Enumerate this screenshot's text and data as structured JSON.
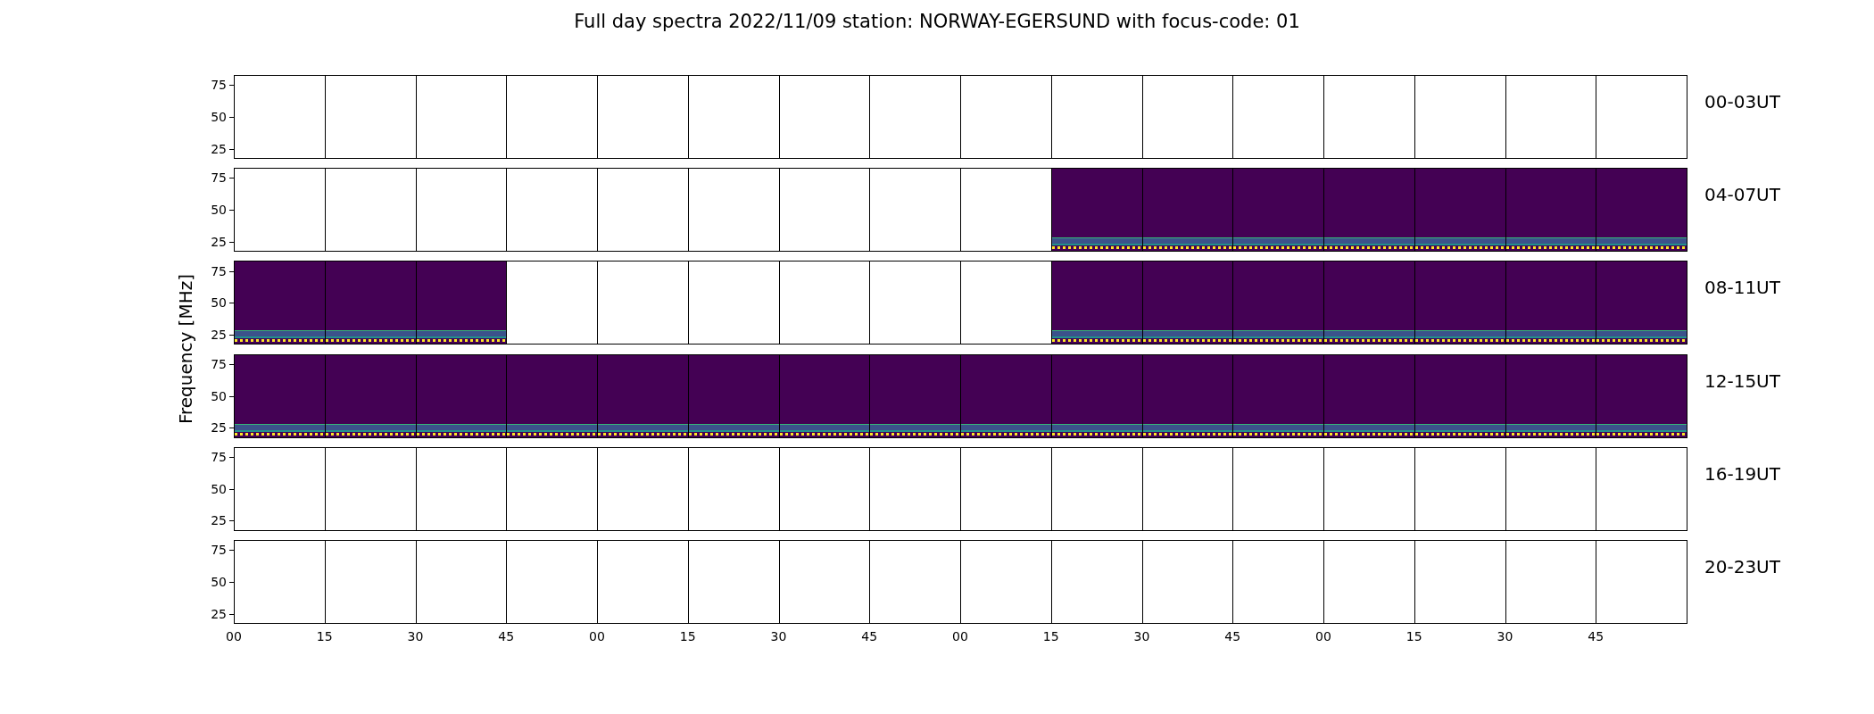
{
  "title": "Full day spectra 2022/11/09 station: NORWAY-EGERSUND with focus-code: 01",
  "ylabel": "Frequency [MHz]",
  "rows": [
    {
      "label": "00-03UT",
      "yticks": [
        "75",
        "50",
        "25"
      ],
      "panels": [
        {
          "has_data": false
        },
        {
          "has_data": false
        },
        {
          "has_data": false
        },
        {
          "has_data": false
        },
        {
          "has_data": false
        },
        {
          "has_data": false
        },
        {
          "has_data": false
        },
        {
          "has_data": false
        },
        {
          "has_data": false
        },
        {
          "has_data": false
        },
        {
          "has_data": false
        },
        {
          "has_data": false
        },
        {
          "has_data": false
        },
        {
          "has_data": false
        },
        {
          "has_data": false
        },
        {
          "has_data": false
        }
      ]
    },
    {
      "label": "04-07UT",
      "yticks": [
        "75",
        "50",
        "25"
      ],
      "panels": [
        {
          "has_data": false
        },
        {
          "has_data": false
        },
        {
          "has_data": false
        },
        {
          "has_data": false
        },
        {
          "has_data": false
        },
        {
          "has_data": false
        },
        {
          "has_data": false
        },
        {
          "has_data": false
        },
        {
          "has_data": false
        },
        {
          "has_data": true
        },
        {
          "has_data": true
        },
        {
          "has_data": true
        },
        {
          "has_data": true
        },
        {
          "has_data": true
        },
        {
          "has_data": true
        },
        {
          "has_data": true
        }
      ]
    },
    {
      "label": "08-11UT",
      "yticks": [
        "75",
        "50",
        "25"
      ],
      "panels": [
        {
          "has_data": true
        },
        {
          "has_data": true
        },
        {
          "has_data": true
        },
        {
          "has_data": false
        },
        {
          "has_data": false
        },
        {
          "has_data": false
        },
        {
          "has_data": false
        },
        {
          "has_data": false
        },
        {
          "has_data": false
        },
        {
          "has_data": true
        },
        {
          "has_data": true
        },
        {
          "has_data": true
        },
        {
          "has_data": true
        },
        {
          "has_data": true
        },
        {
          "has_data": true
        },
        {
          "has_data": true
        }
      ]
    },
    {
      "label": "12-15UT",
      "yticks": [
        "75",
        "50",
        "25"
      ],
      "panels": [
        {
          "has_data": true
        },
        {
          "has_data": true
        },
        {
          "has_data": true
        },
        {
          "has_data": true
        },
        {
          "has_data": true
        },
        {
          "has_data": true
        },
        {
          "has_data": true
        },
        {
          "has_data": true
        },
        {
          "has_data": true
        },
        {
          "has_data": true
        },
        {
          "has_data": true
        },
        {
          "has_data": true
        },
        {
          "has_data": true
        },
        {
          "has_data": true
        },
        {
          "has_data": true
        },
        {
          "has_data": true
        }
      ]
    },
    {
      "label": "16-19UT",
      "yticks": [
        "75",
        "50",
        "25"
      ],
      "panels": [
        {
          "has_data": false
        },
        {
          "has_data": false
        },
        {
          "has_data": false
        },
        {
          "has_data": false
        },
        {
          "has_data": false
        },
        {
          "has_data": false
        },
        {
          "has_data": false
        },
        {
          "has_data": false
        },
        {
          "has_data": false
        },
        {
          "has_data": false
        },
        {
          "has_data": false
        },
        {
          "has_data": false
        },
        {
          "has_data": false
        },
        {
          "has_data": false
        },
        {
          "has_data": false
        },
        {
          "has_data": false
        }
      ]
    },
    {
      "label": "20-23UT",
      "yticks": [
        "75",
        "50",
        "25"
      ],
      "panels": [
        {
          "has_data": false
        },
        {
          "has_data": false
        },
        {
          "has_data": false
        },
        {
          "has_data": false
        },
        {
          "has_data": false
        },
        {
          "has_data": false
        },
        {
          "has_data": false
        },
        {
          "has_data": false
        },
        {
          "has_data": false
        },
        {
          "has_data": false
        },
        {
          "has_data": false
        },
        {
          "has_data": false
        },
        {
          "has_data": false
        },
        {
          "has_data": false
        },
        {
          "has_data": false
        },
        {
          "has_data": false
        }
      ]
    }
  ],
  "xticks": [
    "00",
    "15",
    "30",
    "45",
    "00",
    "15",
    "30",
    "45",
    "00",
    "15",
    "30",
    "45",
    "00",
    "15",
    "30",
    "45"
  ]
}
